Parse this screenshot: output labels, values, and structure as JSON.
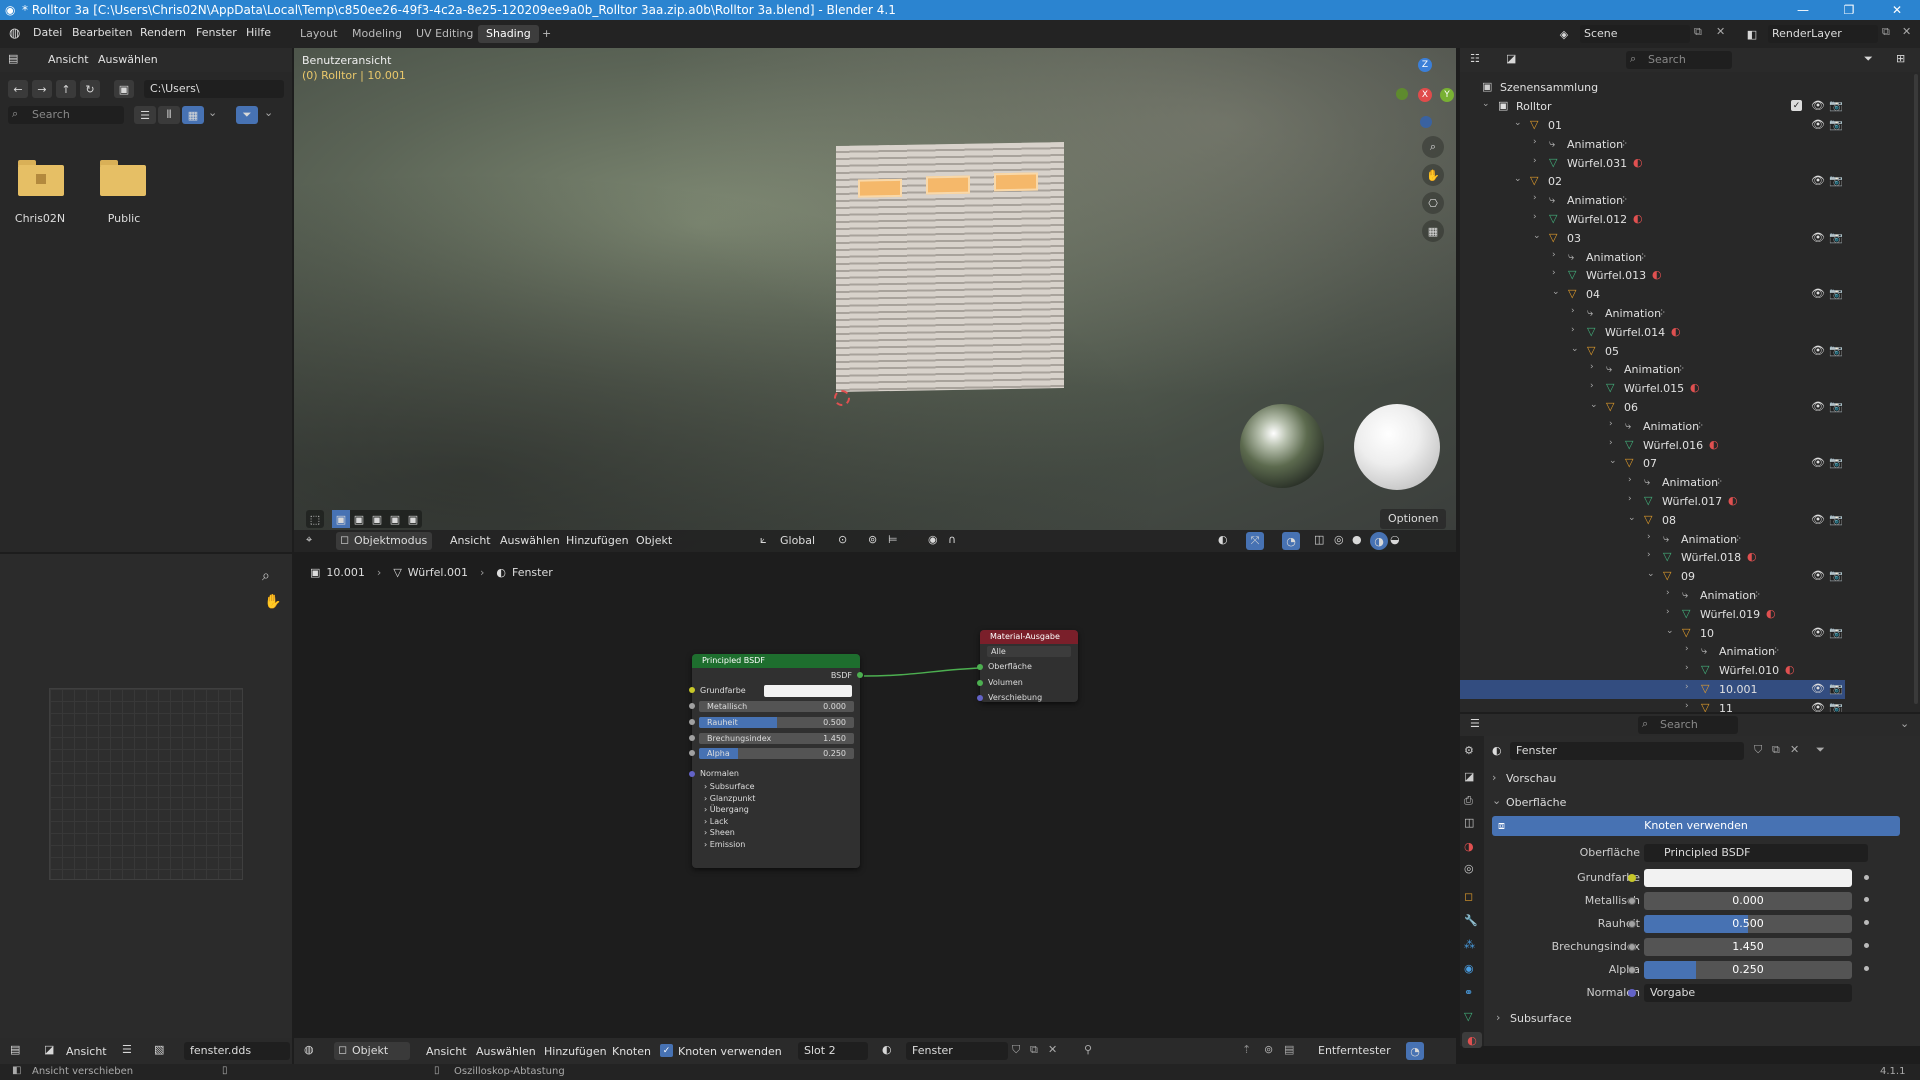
{
  "window": {
    "title": "* Rolltor 3a [C:\\Users\\Chris02N\\AppData\\Local\\Temp\\c850ee26-49f3-4c2a-8e25-120209ee9a0b_Rolltor 3aa.zip.a0b\\Rolltor 3a.blend] - Blender 4.1",
    "min": "—",
    "max": "❐",
    "close": "✕"
  },
  "menu": {
    "file": "Datei",
    "edit": "Bearbeiten",
    "render": "Rendern",
    "window": "Fenster",
    "help": "Hilfe"
  },
  "workspaces": [
    "Layout",
    "Modeling",
    "UV Editing",
    "Shading",
    "+"
  ],
  "topright": {
    "scene": "Scene",
    "renderlayer": "RenderLayer"
  },
  "filebrowser": {
    "view": "Ansicht",
    "select": "Auswählen",
    "path": "C:\\Users\\",
    "search": "Search",
    "folders": [
      "Chris02N",
      "Public"
    ]
  },
  "viewport": {
    "view_name": "Benutzeransicht",
    "object_info": "(0) Rolltor | 10.001",
    "options": "Optionen",
    "mode": "Objektmodus",
    "view": "Ansicht",
    "select": "Auswählen",
    "add": "Hinzufügen",
    "object": "Objekt",
    "orientation": "Global"
  },
  "node_editor": {
    "breadcrumb": [
      "10.001",
      "Würfel.001",
      "Fenster"
    ],
    "bsdf": {
      "title": "Principled BSDF",
      "out": "BSDF",
      "base_color": "Grundfarbe",
      "inputs": [
        {
          "label": "Metallisch",
          "value": "0.000",
          "fraction": 0
        },
        {
          "label": "Rauheit",
          "value": "0.500",
          "fraction": 0.5
        },
        {
          "label": "Brechungsindex",
          "value": "1.450",
          "fraction": 0
        },
        {
          "label": "Alpha",
          "value": "0.250",
          "fraction": 0.25
        }
      ],
      "normal": "Normalen",
      "panels": [
        "Subsurface",
        "Glanzpunkt",
        "Übergang",
        "Lack",
        "Sheen",
        "Emission"
      ]
    },
    "output": {
      "title": "Material-Ausgabe",
      "target": "Alle",
      "sockets": [
        "Oberfläche",
        "Volumen",
        "Verschiebung"
      ]
    },
    "footer": {
      "object": "Objekt",
      "view": "Ansicht",
      "select": "Auswählen",
      "add": "Hinzufügen",
      "node": "Knoten",
      "use_nodes": "Knoten verwenden",
      "slot": "Slot 2",
      "material": "Fenster",
      "snap": "Entferntester"
    }
  },
  "image_editor": {
    "view": "Ansicht",
    "image": "fenster.dds"
  },
  "status": {
    "left": "Ansicht verschieben",
    "mid": "Oszilloskop-Abtastung",
    "version": "4.1.1"
  },
  "outliner": {
    "search": "Search",
    "root": "Szenensammlung",
    "collection": "Rolltor",
    "items": [
      {
        "depth": 0,
        "type": "empty",
        "label": "01",
        "open": true
      },
      {
        "depth": 1,
        "type": "anim",
        "label": "Animation"
      },
      {
        "depth": 1,
        "type": "mesh",
        "label": "Würfel.031"
      },
      {
        "depth": 0,
        "type": "empty",
        "label": "02",
        "open": true
      },
      {
        "depth": 1,
        "type": "anim",
        "label": "Animation"
      },
      {
        "depth": 1,
        "type": "mesh",
        "label": "Würfel.012"
      },
      {
        "depth": 1,
        "type": "empty",
        "label": "03",
        "open": true
      },
      {
        "depth": 2,
        "type": "anim",
        "label": "Animation"
      },
      {
        "depth": 2,
        "type": "mesh",
        "label": "Würfel.013"
      },
      {
        "depth": 2,
        "type": "empty",
        "label": "04",
        "open": true
      },
      {
        "depth": 3,
        "type": "anim",
        "label": "Animation"
      },
      {
        "depth": 3,
        "type": "mesh",
        "label": "Würfel.014"
      },
      {
        "depth": 3,
        "type": "empty",
        "label": "05",
        "open": true
      },
      {
        "depth": 4,
        "type": "anim",
        "label": "Animation"
      },
      {
        "depth": 4,
        "type": "mesh",
        "label": "Würfel.015"
      },
      {
        "depth": 4,
        "type": "empty",
        "label": "06",
        "open": true
      },
      {
        "depth": 5,
        "type": "anim",
        "label": "Animation"
      },
      {
        "depth": 5,
        "type": "mesh",
        "label": "Würfel.016"
      },
      {
        "depth": 5,
        "type": "empty",
        "label": "07",
        "open": true
      },
      {
        "depth": 6,
        "type": "anim",
        "label": "Animation"
      },
      {
        "depth": 6,
        "type": "mesh",
        "label": "Würfel.017"
      },
      {
        "depth": 6,
        "type": "empty",
        "label": "08",
        "open": true
      },
      {
        "depth": 7,
        "type": "anim",
        "label": "Animation"
      },
      {
        "depth": 7,
        "type": "mesh",
        "label": "Würfel.018"
      },
      {
        "depth": 7,
        "type": "empty",
        "label": "09",
        "open": true
      },
      {
        "depth": 8,
        "type": "anim",
        "label": "Animation"
      },
      {
        "depth": 8,
        "type": "mesh",
        "label": "Würfel.019"
      },
      {
        "depth": 8,
        "type": "empty",
        "label": "10",
        "open": true
      },
      {
        "depth": 9,
        "type": "anim",
        "label": "Animation"
      },
      {
        "depth": 9,
        "type": "mesh",
        "label": "Würfel.010"
      },
      {
        "depth": 9,
        "type": "empty",
        "label": "10.001",
        "selected": true
      },
      {
        "depth": 9,
        "type": "empty",
        "label": "11"
      }
    ]
  },
  "properties": {
    "search": "Search",
    "material": "Fenster",
    "preview": "Vorschau",
    "surface_panel": "Oberfläche",
    "use_nodes": "Knoten verwenden",
    "surface_label": "Oberfläche",
    "surface_value": "Principled BSDF",
    "base_color": "Grundfarbe",
    "rows": [
      {
        "label": "Metallisch",
        "value": "0.000",
        "fraction": 0
      },
      {
        "label": "Rauheit",
        "value": "0.500",
        "fraction": 0.5
      },
      {
        "label": "Brechungsindex",
        "value": "1.450",
        "fraction": 0
      },
      {
        "label": "Alpha",
        "value": "0.250",
        "fraction": 0.25
      }
    ],
    "normal_label": "Normalen",
    "normal_value": "Vorgabe",
    "subsurface": "Subsurface"
  },
  "colors": {
    "accent": "#4772b3",
    "title": "#2b84d0",
    "selected": "#334d80",
    "bsdf_header": "#1e6e2e",
    "output_header": "#7a1f2a",
    "empty_icon": "#e29d2b",
    "mesh_icon": "#43b37d"
  }
}
